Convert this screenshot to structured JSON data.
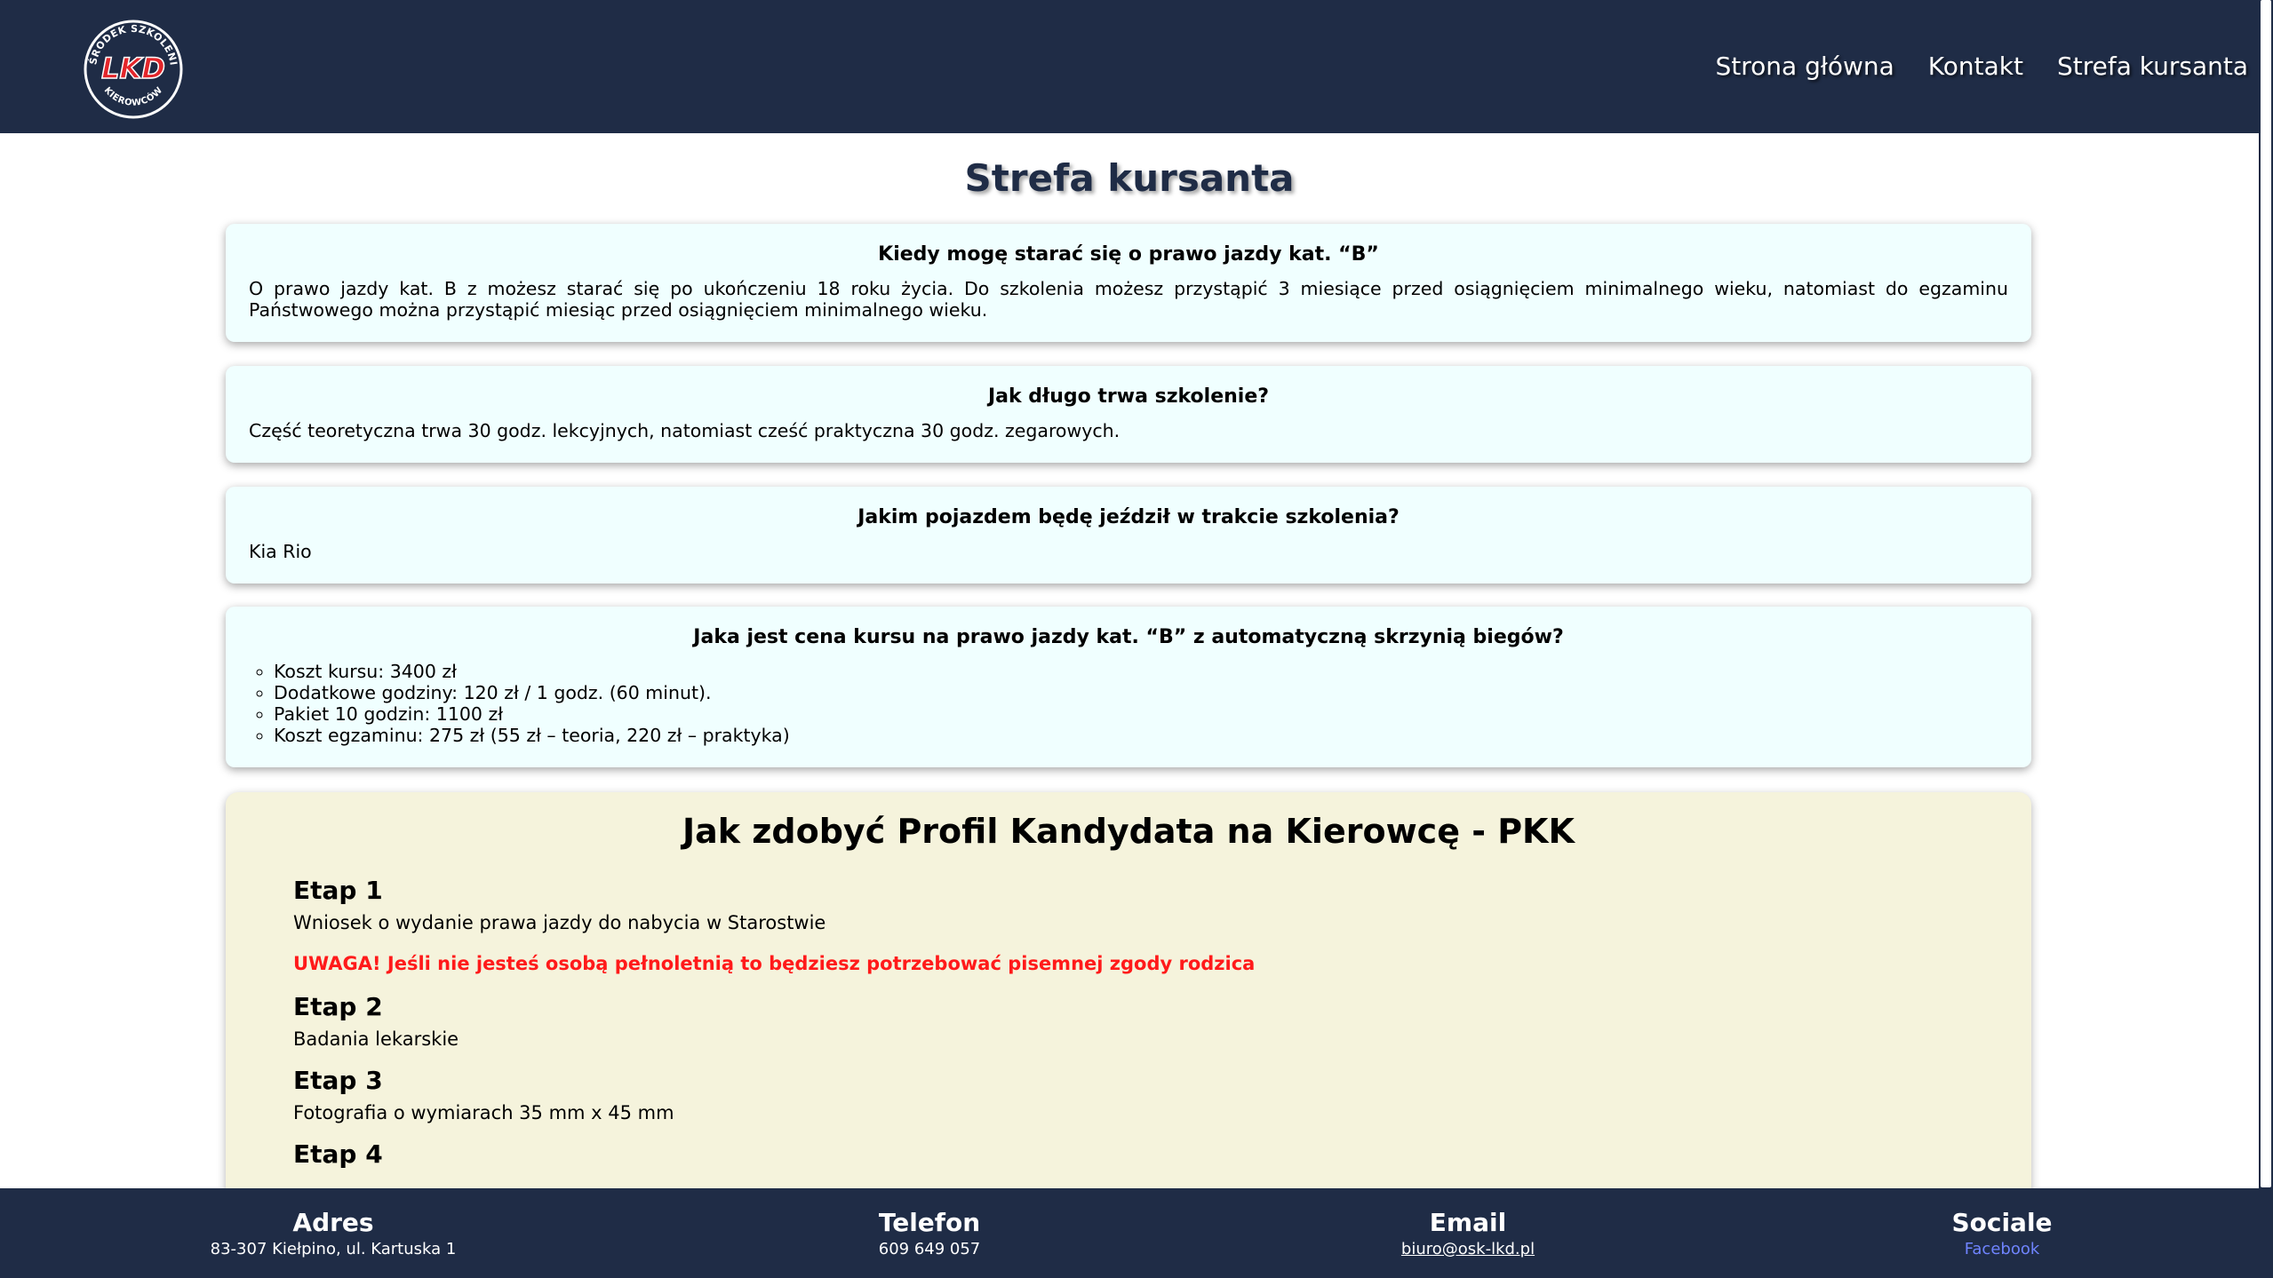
{
  "header": {
    "logo": {
      "top_text": "OŚRODEK SZKOLENIA",
      "brand": "LKD",
      "bottom_text": "KIEROWCÓW"
    },
    "nav": [
      {
        "label": "Strona główna"
      },
      {
        "label": "Kontakt"
      },
      {
        "label": "Strefa kursanta"
      }
    ]
  },
  "main": {
    "title": "Strefa kursanta",
    "faq": [
      {
        "question": "Kiedy mogę starać się o prawo jazdy kat. “B”",
        "answer": "O prawo jazdy kat. B z możesz starać się po ukończeniu 18 roku życia. Do szkolenia możesz przystąpić 3 miesiące przed osiągnięciem minimalnego wieku, natomiast do egzaminu Państwowego można przystąpić miesiąc przed osiągnięciem minimalnego wieku."
      },
      {
        "question": "Jak długo trwa szkolenie?",
        "answer": "Część teoretyczna trwa 30 godz. lekcyjnych, natomiast cześć praktyczna 30 godz. zegarowych."
      },
      {
        "question": "Jakim pojazdem będę jeździł w trakcie szkolenia?",
        "answer": "Kia Rio"
      },
      {
        "question": "Jaka jest cena kursu na prawo jazdy kat. “B” z automatyczną skrzynią biegów?",
        "items": [
          "Koszt kursu: 3400 zł",
          "Dodatkowe godziny: 120 zł / 1 godz. (60 minut).",
          "Pakiet 10 godzin: 1100 zł",
          "Koszt egzaminu: 275 zł (55 zł – teoria, 220 zł – praktyka)"
        ]
      }
    ],
    "pkk": {
      "title": "Jak zdobyć Profil Kandydata na Kierowcę - PKK",
      "stages": [
        {
          "title": "Etap 1",
          "text": "Wniosek o wydanie prawa jazdy do nabycia w Starostwie"
        },
        {
          "title": "Etap 2",
          "text": "Badania lekarskie"
        },
        {
          "title": "Etap 3",
          "text": "Fotografia o wymiarach 35 mm x 45 mm"
        },
        {
          "title": "Etap 4"
        }
      ],
      "warning": "UWAGA! Jeśli nie jesteś osobą pełnoletnią to będziesz potrzebować pisemnej zgody rodzica"
    }
  },
  "footer": {
    "address": {
      "heading": "Adres",
      "value": "83-307 Kiełpino, ul. Kartuska 1"
    },
    "phone": {
      "heading": "Telefon",
      "value": "609 649 057"
    },
    "email": {
      "heading": "Email",
      "value": "biuro@osk-lkd.pl"
    },
    "social": {
      "heading": "Sociale",
      "value": "Facebook"
    }
  },
  "colors": {
    "header_bg": "#1f2c46",
    "faq_bg": "#f0ffff",
    "pkk_bg": "#f5f3dc",
    "warning": "#ff1a1a",
    "logo_red": "#e3262b"
  }
}
